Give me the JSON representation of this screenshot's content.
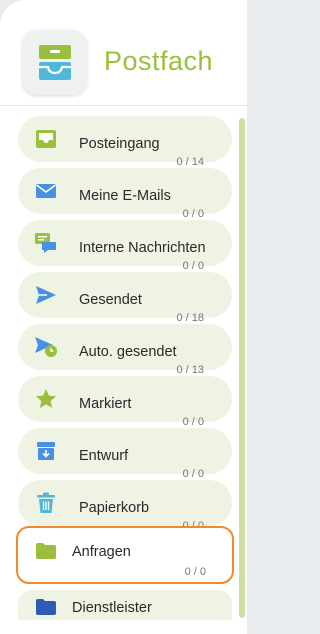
{
  "header": {
    "title": "Postfach",
    "logo_icon": "inbox-tray-icon"
  },
  "colors": {
    "accent": "#9abf3c",
    "item_bg": "#eef3e4",
    "icon_blue": "#4a90e2",
    "highlight": "#f08a2a"
  },
  "folders": [
    {
      "label": "Posteingang",
      "count": "0 / 14",
      "icon": "inbox-icon"
    },
    {
      "label": "Meine E-Mails",
      "count": "0 / 0",
      "icon": "envelope-icon"
    },
    {
      "label": "Interne Nachrichten",
      "count": "0 / 0",
      "icon": "chat-icon"
    },
    {
      "label": "Gesendet",
      "count": "0 / 18",
      "icon": "send-icon"
    },
    {
      "label": "Auto. gesendet",
      "count": "0 / 13",
      "icon": "scheduled-send-icon"
    },
    {
      "label": "Markiert",
      "count": "0 / 0",
      "icon": "star-icon"
    },
    {
      "label": "Entwurf",
      "count": "0 / 0",
      "icon": "draft-icon"
    },
    {
      "label": "Papierkorb",
      "count": "0 / 0",
      "icon": "trash-icon"
    },
    {
      "label": "Anfragen",
      "count": "0 / 0",
      "icon": "folder-icon"
    },
    {
      "label": "Dienstleister",
      "count": "",
      "icon": "folder-icon"
    }
  ]
}
